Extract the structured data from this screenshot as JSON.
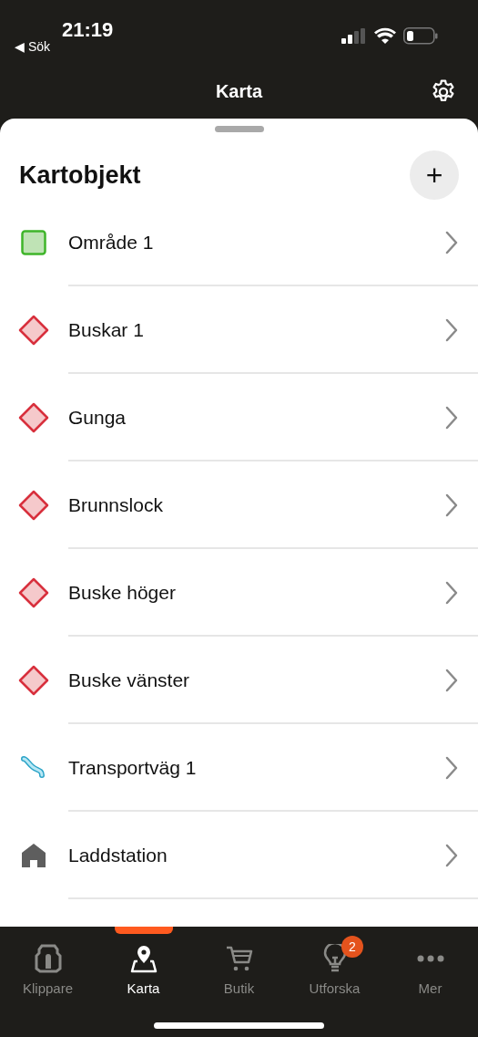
{
  "status_bar": {
    "time": "21:19",
    "back": "◀ Sök"
  },
  "header": {
    "title": "Karta"
  },
  "sheet": {
    "title": "Kartobjekt",
    "add": "+"
  },
  "items": [
    {
      "label": "Område 1",
      "kind": "area"
    },
    {
      "label": "Buskar 1",
      "kind": "obstacle"
    },
    {
      "label": "Gunga",
      "kind": "obstacle"
    },
    {
      "label": "Brunnslock",
      "kind": "obstacle"
    },
    {
      "label": "Buske höger",
      "kind": "obstacle"
    },
    {
      "label": "Buske vänster",
      "kind": "obstacle"
    },
    {
      "label": "Transportväg 1",
      "kind": "path"
    },
    {
      "label": "Laddstation",
      "kind": "station"
    }
  ],
  "tabs": [
    {
      "label": "Klippare",
      "kind": "mower",
      "selected": false
    },
    {
      "label": "Karta",
      "kind": "map",
      "selected": true
    },
    {
      "label": "Butik",
      "kind": "cart",
      "selected": false
    },
    {
      "label": "Utforska",
      "kind": "bulb",
      "selected": false,
      "badge": "2"
    },
    {
      "label": "Mer",
      "kind": "more",
      "selected": false
    }
  ]
}
